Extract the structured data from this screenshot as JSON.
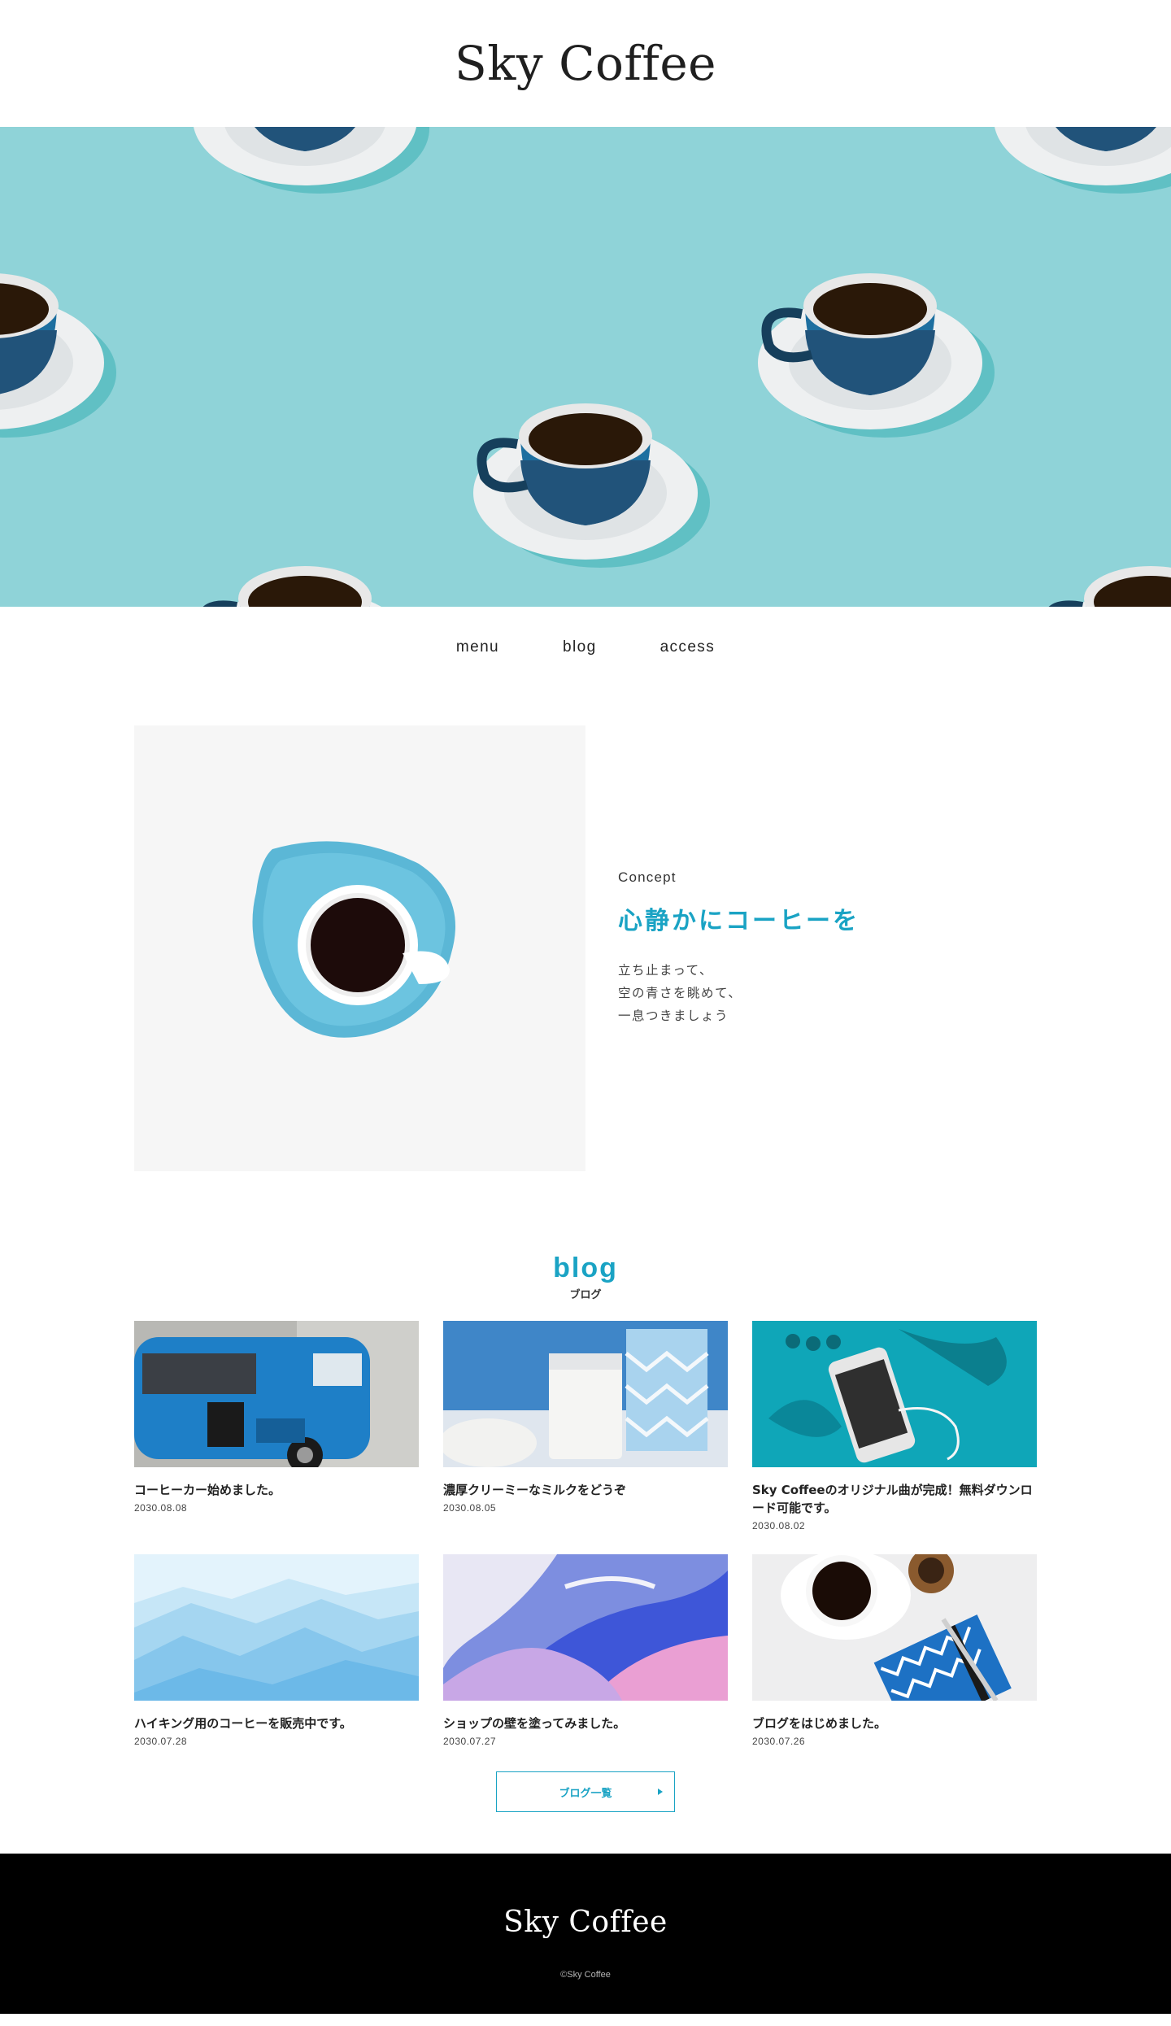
{
  "header": {
    "logo": "Sky Coffee"
  },
  "nav": {
    "items": [
      "menu",
      "blog",
      "access"
    ]
  },
  "concept": {
    "label": "Concept",
    "heading": "心静かにコーヒーを",
    "lines": [
      "立ち止まって、",
      "空の青さを眺めて、",
      "一息つきましょう"
    ]
  },
  "blog": {
    "title": "blog",
    "subtitle": "ブログ",
    "posts": [
      {
        "title": "コーヒーカー始めました。",
        "date": "2030.08.08"
      },
      {
        "title": "濃厚クリーミーなミルクをどうぞ",
        "date": "2030.08.05"
      },
      {
        "title": "Sky Coffeeのオリジナル曲が完成！無料ダウンロード可能です。",
        "date": "2030.08.02"
      },
      {
        "title": "ハイキング用のコーヒーを販売中です。",
        "date": "2030.07.28"
      },
      {
        "title": "ショップの壁を塗ってみました。",
        "date": "2030.07.27"
      },
      {
        "title": "ブログをはじめました。",
        "date": "2030.07.26"
      }
    ],
    "more_label": "ブログ一覧"
  },
  "footer": {
    "logo": "Sky Coffee",
    "copyright": "©Sky Coffee"
  },
  "colors": {
    "accent": "#1aa3c4",
    "hero_bg": "#8fd3d8",
    "footer_bg": "#000000"
  }
}
